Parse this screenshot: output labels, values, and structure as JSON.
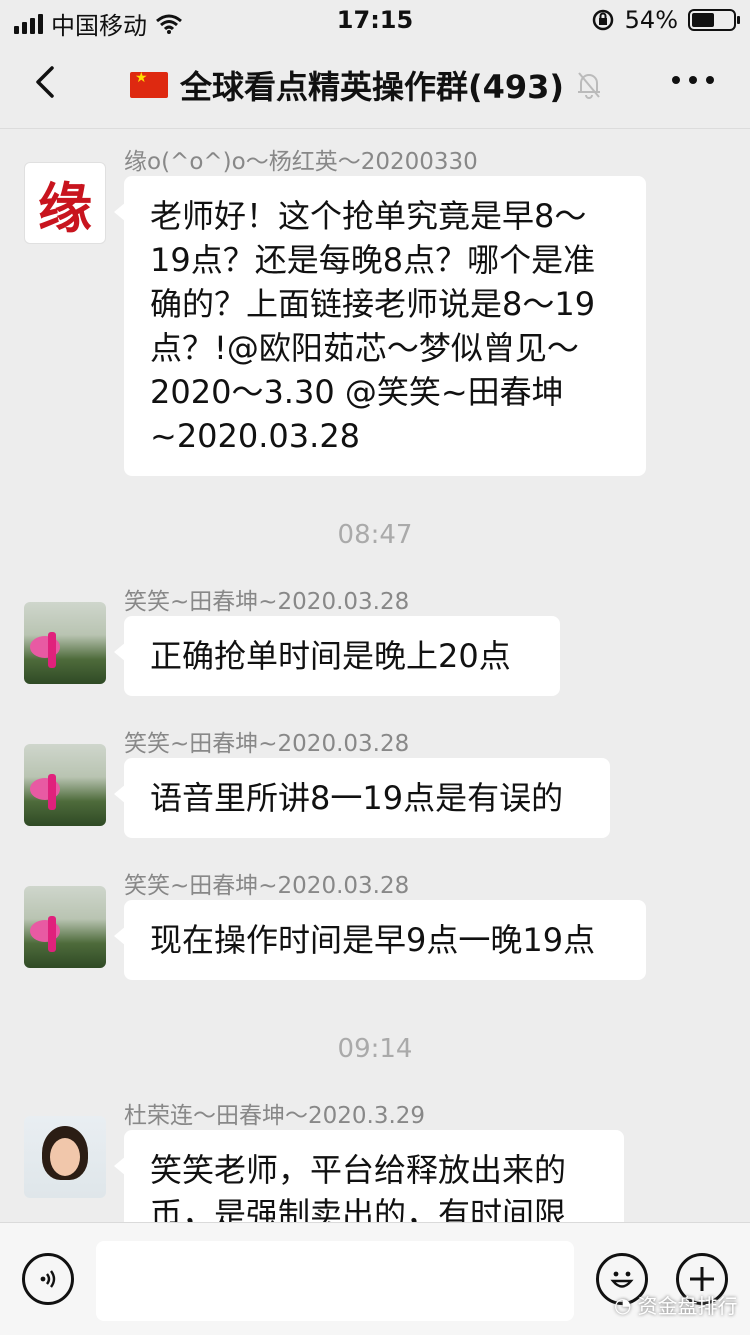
{
  "status_bar": {
    "carrier": "中国移动",
    "time": "17:15",
    "battery_percent": "54%",
    "battery_level": 0.54,
    "icons": [
      "signal-icon",
      "wifi-icon",
      "orientation-lock-icon",
      "battery-icon"
    ]
  },
  "nav": {
    "title": "全球看点精英操作群(493)",
    "icons": [
      "back-icon",
      "china-flag-icon",
      "mute-bell-icon",
      "more-icon"
    ]
  },
  "messages": [
    {
      "sender": "缘o(^o^)o～杨红英～20200330",
      "lines": [
        "老师好！这个抢单究竟是早8～",
        "19点？还是每晚8点？哪个是准",
        "确的？上面链接老师说是8～19",
        "点？!@欧阳茹芯～梦似曾见～",
        "2020～3.30 @笑笑~田春坤",
        "~2020.03.28"
      ],
      "avatar_text": "缘"
    },
    {
      "sender": "笑笑~田春坤~2020.03.28",
      "lines": [
        "正确抢单时间是晚上20点"
      ]
    },
    {
      "sender": "笑笑~田春坤~2020.03.28",
      "lines": [
        "语音里所讲8一19点是有误的"
      ]
    },
    {
      "sender": "笑笑~田春坤~2020.03.28",
      "lines": [
        "现在操作时间是早9点一晚19点"
      ]
    },
    {
      "sender": "杜荣连～田春坤～2020.3.29",
      "lines": [
        "笑笑老师，平台给释放出来的",
        "币，是强制卖出的，有时间限"
      ]
    }
  ],
  "timestamps": [
    "08:47",
    "09:14"
  ],
  "input_bar": {
    "icons": [
      "voice-icon",
      "emoji-icon",
      "plus-icon"
    ],
    "input_value": ""
  },
  "watermark": "资金盘排行"
}
